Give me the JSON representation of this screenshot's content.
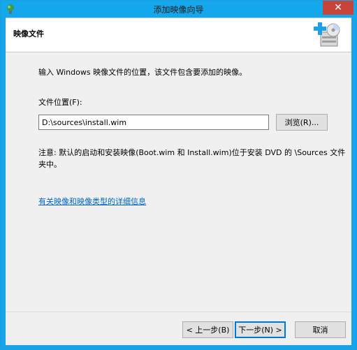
{
  "window": {
    "title": "添加映像向导",
    "close_glyph": "✕"
  },
  "header": {
    "title": "映像文件",
    "icon": "add-image-disk-icon"
  },
  "body": {
    "intro": "输入 Windows 映像文件的位置，该文件包含要添加的映像。",
    "location_label": "文件位置(F):",
    "location_value": "D:\\sources\\install.wim",
    "browse_label": "浏览(R)...",
    "note_line1": "注意: 默认的启动和安装映像(Boot.wim 和 Install.wim)位于安装 DVD 的 \\Sources 文件",
    "note_line2": "夹中。",
    "info_link": "有关映像和映像类型的详细信息"
  },
  "footer": {
    "back_label": "< 上一步(B)",
    "next_label": "下一步(N) >",
    "cancel_label": "取消"
  },
  "colors": {
    "titlebar": "#15a7eb",
    "close": "#c7443b",
    "link": "#0066cc"
  }
}
